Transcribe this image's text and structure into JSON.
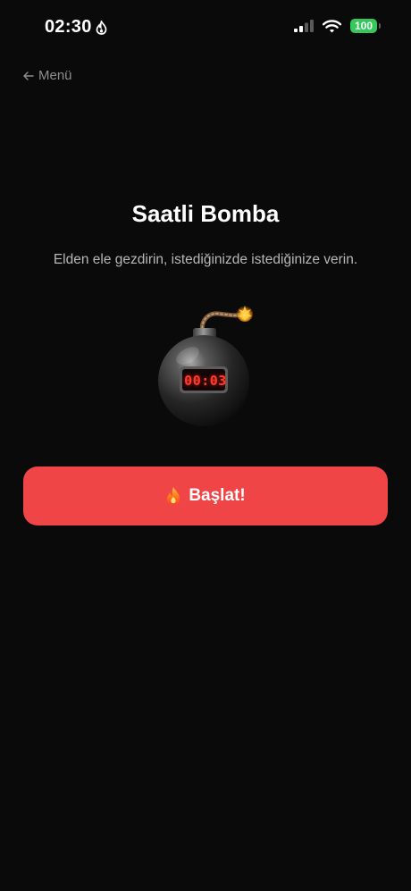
{
  "status_bar": {
    "time": "02:30",
    "battery": "100",
    "battery_color": "#34c759"
  },
  "nav": {
    "back_label": "Menü",
    "back_icon": "arrow-left-icon"
  },
  "game": {
    "title": "Saatli Bomba",
    "description": "Elden ele gezdirin, istediğinizde istediğinize verin.",
    "timer": "00:03"
  },
  "start_button": {
    "label": "Başlat!",
    "icon": "fire-icon",
    "color": "#ef4547"
  }
}
